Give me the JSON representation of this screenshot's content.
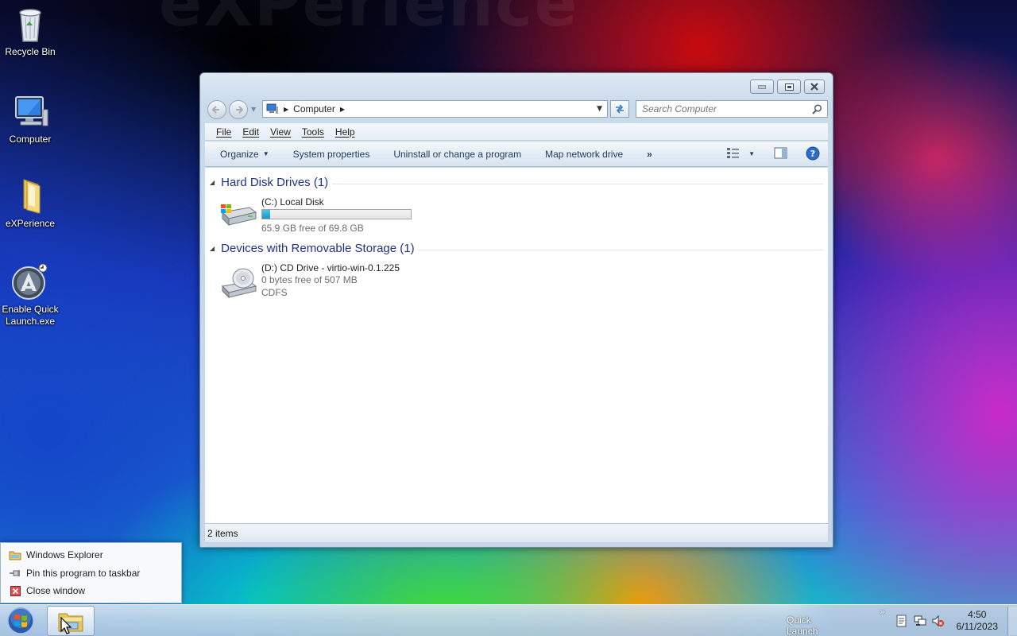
{
  "desktop": {
    "icons": [
      {
        "label": "Recycle Bin"
      },
      {
        "label": "Computer"
      },
      {
        "label": "eXPerience"
      },
      {
        "label": "Enable Quick Launch.exe"
      }
    ]
  },
  "window": {
    "address": {
      "crumb": "Computer"
    },
    "search": {
      "placeholder": "Search Computer"
    },
    "menu": [
      "File",
      "Edit",
      "View",
      "Tools",
      "Help"
    ],
    "commands": {
      "organize": "Organize",
      "system_properties": "System properties",
      "uninstall": "Uninstall or change a program",
      "map_drive": "Map network drive",
      "more": "»"
    },
    "groups": [
      {
        "title": "Hard Disk Drives (1)",
        "items": [
          {
            "name": "(C:) Local Disk",
            "detail": "65.9 GB free of 69.8 GB",
            "used_fraction": 0.056
          }
        ]
      },
      {
        "title": "Devices with Removable Storage (1)",
        "items": [
          {
            "name": "(D:) CD Drive - virtio-win-0.1.225",
            "detail": "0 bytes free of 507 MB",
            "fs": "CDFS"
          }
        ]
      }
    ],
    "status": "2 items"
  },
  "jumplist": {
    "items": [
      "Windows Explorer",
      "Pin this program to taskbar",
      "Close window"
    ]
  },
  "taskbar": {
    "quick_launch": "Quick Launch",
    "quick_launch_chevron": "»",
    "time": "4:50",
    "date": "6/11/2023"
  }
}
